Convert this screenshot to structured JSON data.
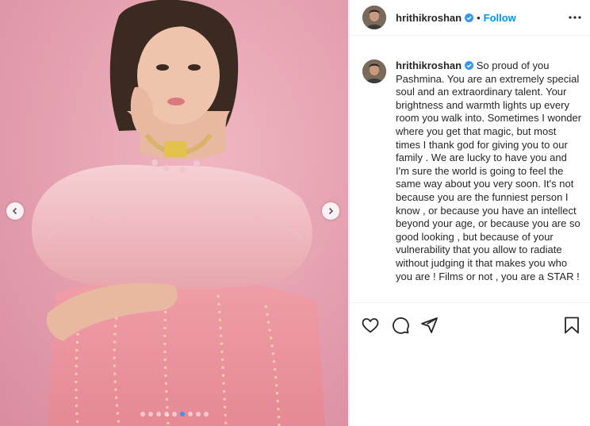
{
  "post": {
    "username": "hrithikroshan",
    "follow_separator": "•",
    "follow_label": "Follow",
    "caption": "So proud of you Pashmina. You are an extremely special soul and an extraordinary talent. Your brightness and warmth lights up every room you walk into. Sometimes I wonder where you get that magic, but most times I thank god for giving you to our family . We are lucky to have you and I'm sure the world is going to feel the same way about you very soon. It's not because you are the funniest person I know , or because you have an intellect beyond your age, or because you are so good looking , but because of your vulnerability that you allow to radiate without judging it that makes you who you are ! Films or not , you are a STAR !"
  },
  "carousel": {
    "slide_count": 9,
    "active_index": 5
  },
  "icons": {
    "prev": "chevron-left-icon",
    "next": "chevron-right-icon",
    "more": "more-options-icon",
    "verified": "verified-badge-icon",
    "like": "heart-icon",
    "comment": "comment-icon",
    "share": "share-icon",
    "save": "bookmark-icon"
  },
  "colors": {
    "accent": "#0095f6",
    "background_pink": "#e6a3b2",
    "verified": "#3897f0"
  }
}
